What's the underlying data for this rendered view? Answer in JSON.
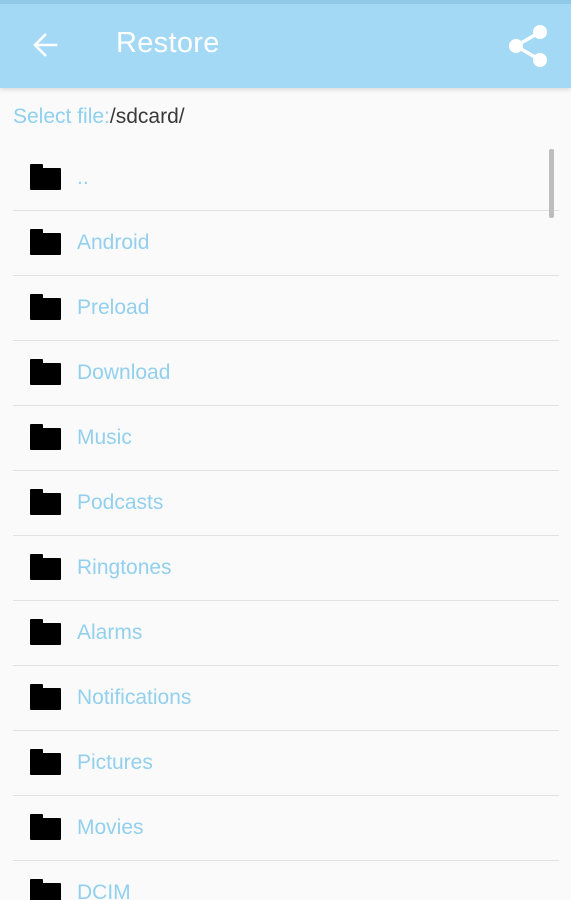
{
  "app": {
    "title": "Restore",
    "accent": "#a3d9f5",
    "back_icon": "arrow-left-icon",
    "share_icon": "share-icon"
  },
  "path": {
    "label": "Select file:",
    "value": "/sdcard/"
  },
  "folders": [
    {
      "label": "..",
      "icon": "folder-icon"
    },
    {
      "label": "Android",
      "icon": "folder-icon"
    },
    {
      "label": "Preload",
      "icon": "folder-icon"
    },
    {
      "label": "Download",
      "icon": "folder-icon"
    },
    {
      "label": "Music",
      "icon": "folder-icon"
    },
    {
      "label": "Podcasts",
      "icon": "folder-icon"
    },
    {
      "label": "Ringtones",
      "icon": "folder-icon"
    },
    {
      "label": "Alarms",
      "icon": "folder-icon"
    },
    {
      "label": "Notifications",
      "icon": "folder-icon"
    },
    {
      "label": "Pictures",
      "icon": "folder-icon"
    },
    {
      "label": "Movies",
      "icon": "folder-icon"
    },
    {
      "label": "DCIM",
      "icon": "folder-icon"
    }
  ]
}
